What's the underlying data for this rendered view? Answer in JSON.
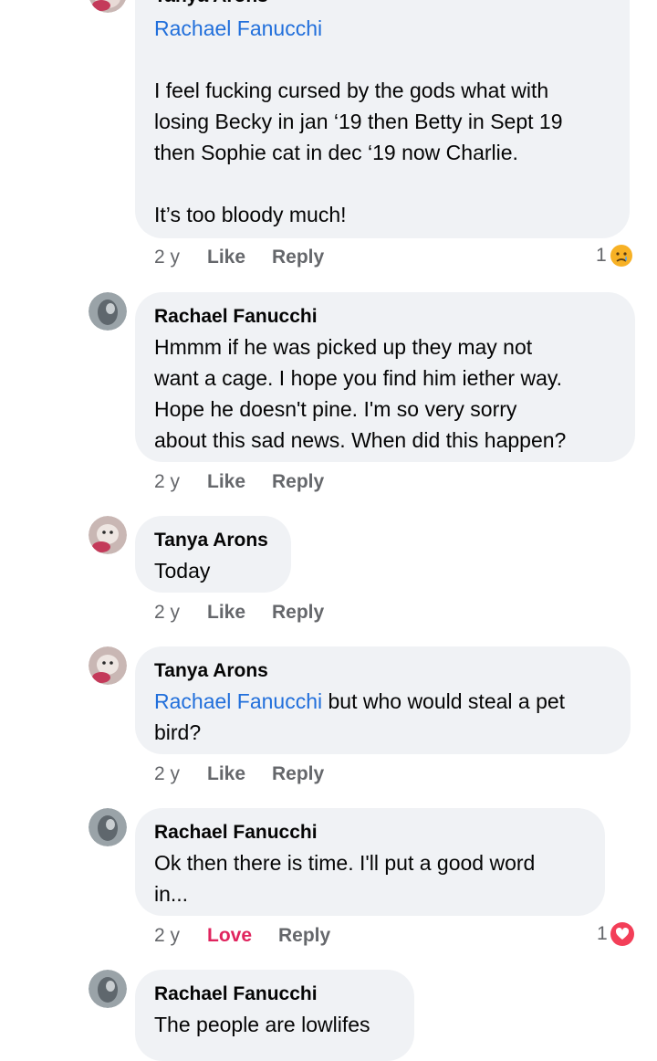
{
  "comments": [
    {
      "author": "Tanya Arons",
      "mention": "Rachael Fanucchi",
      "text_lines": [
        "I feel fucking cursed by the gods what with",
        "losing Becky in jan ‘19 then Betty in Sept 19",
        "then Sophie cat in dec ‘19 now Charlie.",
        "",
        "It’s too bloody much!"
      ],
      "time": "2 y",
      "like": "Like",
      "reply": "Reply",
      "reaction_count": "1",
      "reaction": "sad-face-icon"
    },
    {
      "author": "Rachael Fanucchi",
      "text_lines": [
        "Hmmm if he was picked up they may not",
        "want a cage. I hope you find him iether way.",
        "Hope he doesn't pine. I'm so very sorry",
        "about this sad news. When did this happen?"
      ],
      "time": "2 y",
      "like": "Like",
      "reply": "Reply"
    },
    {
      "author": "Tanya Arons",
      "text_lines": [
        "Today"
      ],
      "time": "2 y",
      "like": "Like",
      "reply": "Reply"
    },
    {
      "author": "Tanya Arons",
      "mention": "Rachael Fanucchi",
      "text_after_mention": " but who would steal a pet",
      "text_lines": [
        "bird?"
      ],
      "time": "2 y",
      "like": "Like",
      "reply": "Reply"
    },
    {
      "author": "Rachael Fanucchi",
      "text_lines": [
        "Ok then there is time. I'll put a good word",
        "in..."
      ],
      "time": "2 y",
      "like": "Love",
      "reply": "Reply",
      "reaction_count": "1",
      "reaction": "heart-icon"
    },
    {
      "author": "Rachael Fanucchi",
      "text_lines": [
        "The people are lowlifes"
      ]
    }
  ],
  "colors": {
    "bubble": "#f0f2f5",
    "mention": "#216fdb",
    "meta": "#65676b",
    "love": "#e0245e"
  }
}
